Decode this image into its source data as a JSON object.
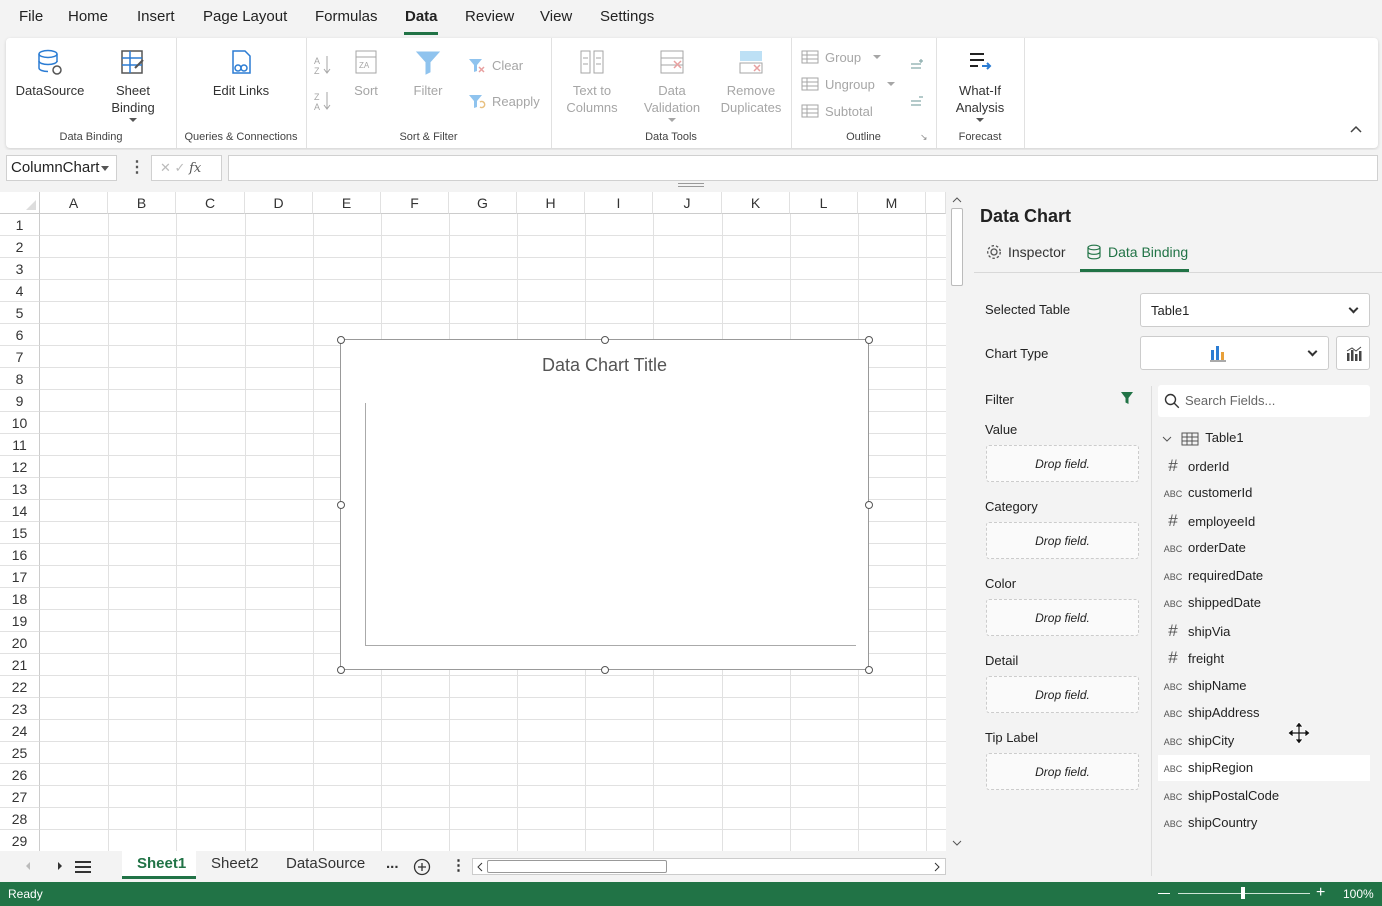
{
  "menu": [
    "File",
    "Home",
    "Insert",
    "Page Layout",
    "Formulas",
    "Data",
    "Review",
    "View",
    "Settings"
  ],
  "menu_active": "Data",
  "ribbon": {
    "data_source": "DataSource",
    "sheet_binding_line1": "Sheet",
    "sheet_binding_line2": "Binding",
    "group_data_binding": "Data Binding",
    "edit_links": "Edit Links",
    "group_queries": "Queries & Connections",
    "sort": "Sort",
    "filter": "Filter",
    "clear": "Clear",
    "reapply": "Reapply",
    "group_sort_filter": "Sort & Filter",
    "text_to_columns_line1": "Text to",
    "text_to_columns_line2": "Columns",
    "data_validation_line1": "Data",
    "data_validation_line2": "Validation",
    "remove_duplicates_line1": "Remove",
    "remove_duplicates_line2": "Duplicates",
    "group_data_tools": "Data Tools",
    "group_btn": "Group",
    "ungroup": "Ungroup",
    "subtotal": "Subtotal",
    "group_outline": "Outline",
    "what_if_line1": "What-If",
    "what_if_line2": "Analysis",
    "group_forecast": "Forecast"
  },
  "formula_bar": {
    "name_box": "ColumnChart",
    "fx": "fx",
    "formula": ""
  },
  "sheet": {
    "columns": [
      "A",
      "B",
      "C",
      "D",
      "E",
      "F",
      "G",
      "H",
      "I",
      "J",
      "K",
      "L",
      "M"
    ],
    "rows": [
      "1",
      "2",
      "3",
      "4",
      "5",
      "6",
      "7",
      "8",
      "9",
      "10",
      "11",
      "12",
      "13",
      "14",
      "15",
      "16",
      "17",
      "18",
      "19",
      "20",
      "21",
      "22",
      "23",
      "24",
      "25",
      "26",
      "27",
      "28",
      "29"
    ]
  },
  "chart": {
    "title": "Data Chart Title"
  },
  "panel": {
    "title": "Data Chart",
    "tab_inspector": "Inspector",
    "tab_binding": "Data Binding",
    "selected_table_label": "Selected Table",
    "selected_table_value": "Table1",
    "chart_type_label": "Chart Type",
    "filter_label": "Filter",
    "wells": [
      {
        "label": "Value",
        "placeholder": "Drop field."
      },
      {
        "label": "Category",
        "placeholder": "Drop field."
      },
      {
        "label": "Color",
        "placeholder": "Drop field."
      },
      {
        "label": "Detail",
        "placeholder": "Drop field."
      },
      {
        "label": "Tip Label",
        "placeholder": "Drop field."
      }
    ],
    "search_placeholder": "Search Fields...",
    "table_name": "Table1",
    "fields": [
      {
        "name": "orderId",
        "type": "#"
      },
      {
        "name": "customerId",
        "type": "ABC"
      },
      {
        "name": "employeeId",
        "type": "#"
      },
      {
        "name": "orderDate",
        "type": "ABC"
      },
      {
        "name": "requiredDate",
        "type": "ABC"
      },
      {
        "name": "shippedDate",
        "type": "ABC"
      },
      {
        "name": "shipVia",
        "type": "#"
      },
      {
        "name": "freight",
        "type": "#"
      },
      {
        "name": "shipName",
        "type": "ABC"
      },
      {
        "name": "shipAddress",
        "type": "ABC"
      },
      {
        "name": "shipCity",
        "type": "ABC"
      },
      {
        "name": "shipRegion",
        "type": "ABC"
      },
      {
        "name": "shipPostalCode",
        "type": "ABC"
      },
      {
        "name": "shipCountry",
        "type": "ABC"
      }
    ]
  },
  "sheet_tabs": [
    "Sheet1",
    "Sheet2",
    "DataSource"
  ],
  "sheet_tab_more": "...",
  "status": {
    "text": "Ready",
    "zoom": "100%"
  },
  "colors": {
    "accent": "#217346"
  }
}
